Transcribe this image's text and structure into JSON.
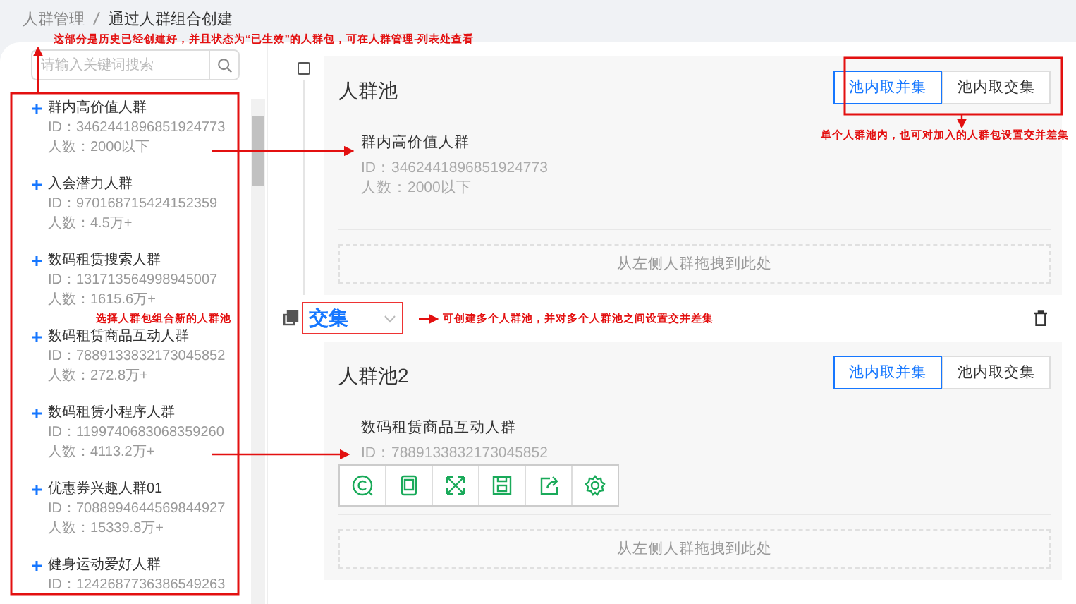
{
  "breadcrumb": [
    {
      "label": "人群管理"
    },
    {
      "label": "通过人群组合创建"
    }
  ],
  "search": {
    "placeholder": "请输入关键词搜索"
  },
  "audiences": [
    {
      "name": "群内高价值人群",
      "id_text": "ID：3462441896851924773",
      "count_text": "人数：2000以下"
    },
    {
      "name": "入会潜力人群",
      "id_text": "ID：970168715424152359",
      "count_text": "人数：4.5万+"
    },
    {
      "name": "数码租赁搜索人群",
      "id_text": "ID：131713564998945007",
      "count_text": "人数：1615.6万+"
    },
    {
      "name": "数码租赁商品互动人群",
      "id_text": "ID：7889133832173045852",
      "count_text": "人数：272.8万+"
    },
    {
      "name": "数码租赁小程序人群",
      "id_text": "ID：1199740683068359260",
      "count_text": "人数：4113.2万+"
    },
    {
      "name": "优惠券兴趣人群01",
      "id_text": "ID：7088994644569844927",
      "count_text": "人数：15339.8万+"
    },
    {
      "name": "健身运动爱好人群",
      "id_text": "ID：1242687736386549263"
    }
  ],
  "pools": [
    {
      "title": "人群池",
      "modes": [
        {
          "label": "池内取并集",
          "selected": true
        },
        {
          "label": "池内取交集",
          "selected": false
        }
      ],
      "members": [
        {
          "name": "群内高价值人群",
          "id_text": "ID：3462441896851924773",
          "count_text": "人数：2000以下"
        }
      ],
      "dropzone": "从左侧人群拖拽到此处",
      "toolbar": false
    },
    {
      "title": "人群池2",
      "modes": [
        {
          "label": "池内取并集",
          "selected": true
        },
        {
          "label": "池内取交集",
          "selected": false
        }
      ],
      "members": [
        {
          "name": "数码租赁商品互动人群",
          "id_text": "ID：7889133832173045852"
        }
      ],
      "dropzone": "从左侧人群拖拽到此处",
      "toolbar": true
    }
  ],
  "operator": {
    "value": "交集"
  },
  "annotations": [
    {
      "text": "这部分是历史已经创建好，并且状态为“已生效”的人群包，可在人群管理-列表处查看"
    },
    {
      "text": "单个人群池内，也可对加入的人群包设置交并差集"
    },
    {
      "text": "选择人群包组合新的人群池"
    },
    {
      "text": "可创建多个人群池，并对多个人群池之间设置交并差集"
    }
  ]
}
